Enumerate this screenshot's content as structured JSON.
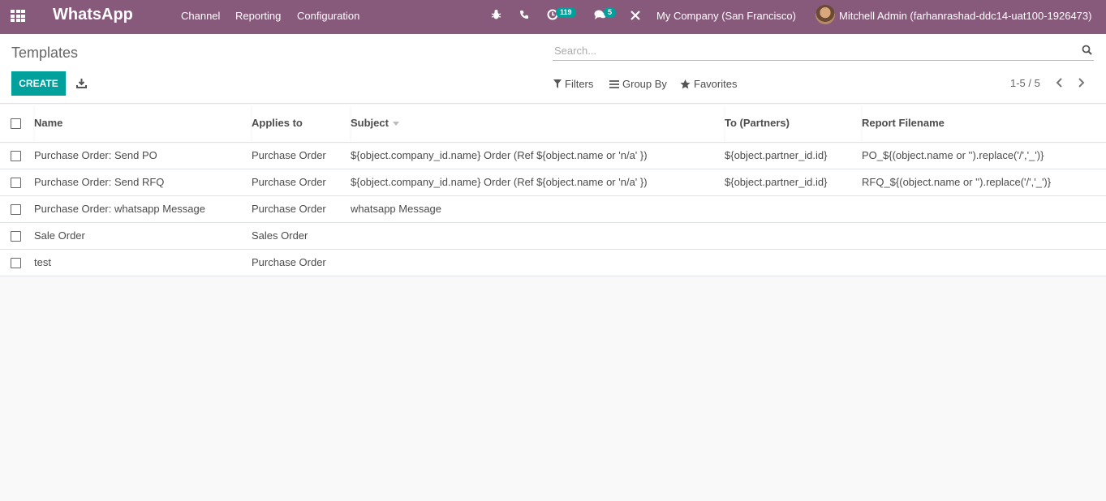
{
  "navbar": {
    "app_name": "WhatsApp",
    "menu": [
      "Channel",
      "Reporting",
      "Configuration"
    ],
    "activity_count": "119",
    "message_count": "5",
    "company": "My Company (San Francisco)",
    "user": "Mitchell Admin (farhanrashad-ddc14-uat100-1926473)",
    "color": "#875a7b"
  },
  "control_panel": {
    "title": "Templates",
    "search_placeholder": "Search...",
    "create_label": "CREATE",
    "filters_label": "Filters",
    "group_by_label": "Group By",
    "favorites_label": "Favorites",
    "pager": "1-5 / 5",
    "accent": "#00a09d"
  },
  "table": {
    "columns": [
      "Name",
      "Applies to",
      "Subject",
      "To (Partners)",
      "Report Filename"
    ],
    "rows": [
      {
        "name": "Purchase Order: Send PO",
        "applies_to": "Purchase Order",
        "subject": "${object.company_id.name} Order (Ref ${object.name or 'n/a' })",
        "to": "${object.partner_id.id}",
        "report": "PO_${(object.name or '').replace('/','_')}"
      },
      {
        "name": "Purchase Order: Send RFQ",
        "applies_to": "Purchase Order",
        "subject": "${object.company_id.name} Order (Ref ${object.name or 'n/a' })",
        "to": "${object.partner_id.id}",
        "report": "RFQ_${(object.name or '').replace('/','_')}"
      },
      {
        "name": "Purchase Order: whatsapp Message",
        "applies_to": "Purchase Order",
        "subject": "whatsapp Message",
        "to": "",
        "report": ""
      },
      {
        "name": "Sale Order",
        "applies_to": "Sales Order",
        "subject": "",
        "to": "",
        "report": ""
      },
      {
        "name": "test",
        "applies_to": "Purchase Order",
        "subject": "",
        "to": "",
        "report": ""
      }
    ]
  }
}
